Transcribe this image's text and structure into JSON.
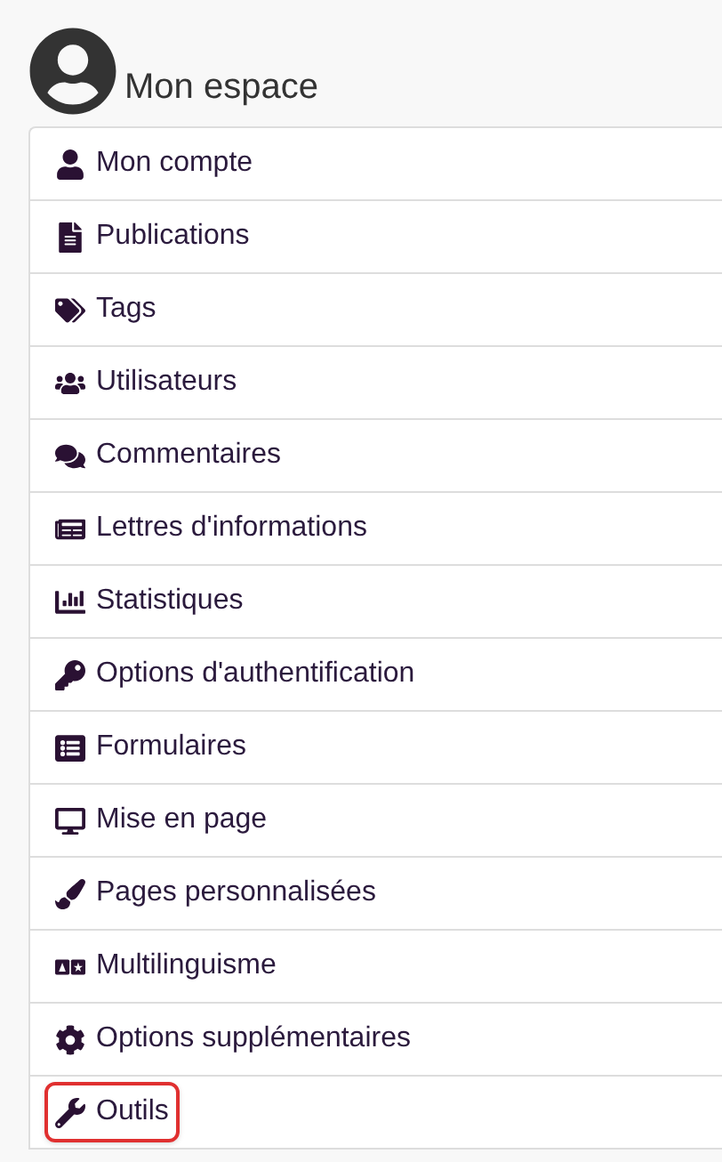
{
  "title": "Mon espace",
  "menu": [
    {
      "label": "Mon compte",
      "highlighted": false
    },
    {
      "label": "Publications",
      "highlighted": false
    },
    {
      "label": "Tags",
      "highlighted": false
    },
    {
      "label": "Utilisateurs",
      "highlighted": false
    },
    {
      "label": "Commentaires",
      "highlighted": false
    },
    {
      "label": "Lettres d'informations",
      "highlighted": false
    },
    {
      "label": "Statistiques",
      "highlighted": false
    },
    {
      "label": "Options d'authentification",
      "highlighted": false
    },
    {
      "label": "Formulaires",
      "highlighted": false
    },
    {
      "label": "Mise en page",
      "highlighted": false
    },
    {
      "label": "Pages personnalisées",
      "highlighted": false
    },
    {
      "label": "Multilinguisme",
      "highlighted": false
    },
    {
      "label": "Options supplémentaires",
      "highlighted": false
    },
    {
      "label": "Outils",
      "highlighted": true
    }
  ]
}
